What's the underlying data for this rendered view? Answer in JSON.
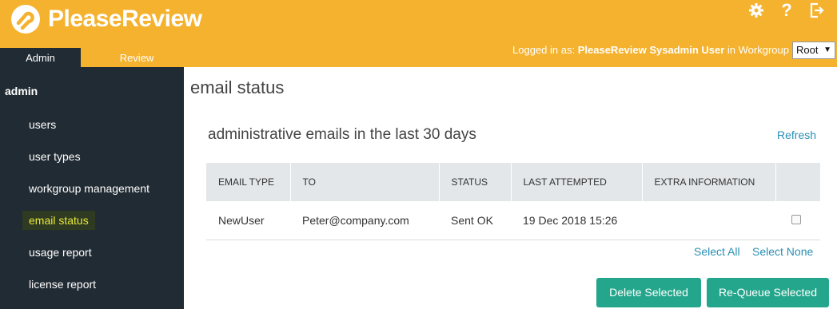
{
  "header": {
    "logo_text": "PleaseReview",
    "icons": [
      "gear-icon",
      "help-icon",
      "logout-icon"
    ],
    "help_glyph": "?",
    "logged_prefix": "Logged in as:",
    "user_name": "PleaseReview Sysadmin User",
    "in_workgroup": "in Workgroup",
    "workgroup_value": "Root",
    "tabs": [
      {
        "label": "Admin",
        "active": true
      },
      {
        "label": "Review",
        "active": false
      }
    ]
  },
  "sidebar": {
    "title": "admin",
    "items": [
      {
        "label": "users"
      },
      {
        "label": "user types"
      },
      {
        "label": "workgroup management"
      },
      {
        "label": "email status",
        "active": true
      },
      {
        "label": "usage report"
      },
      {
        "label": "license report"
      }
    ]
  },
  "main": {
    "page_title": "email status",
    "section_title": "administrative emails in the last 30 days",
    "refresh_label": "Refresh",
    "table": {
      "headers": [
        "EMAIL TYPE",
        "TO",
        "STATUS",
        "LAST ATTEMPTED",
        "EXTRA INFORMATION",
        ""
      ],
      "rows": [
        {
          "email_type": "NewUser",
          "to": "Peter@company.com",
          "status": "Sent OK",
          "last_attempted": "19 Dec 2018 15:26",
          "extra": ""
        }
      ]
    },
    "select_all": "Select All",
    "select_none": "Select None",
    "delete_button": "Delete Selected",
    "requeue_button": "Re-Queue Selected"
  },
  "colors": {
    "header_bg": "#f5b22f",
    "sidebar_bg": "#212b33",
    "accent_link": "#2a8fb5",
    "button": "#23a68b",
    "active_item_text": "#e8e83a"
  }
}
